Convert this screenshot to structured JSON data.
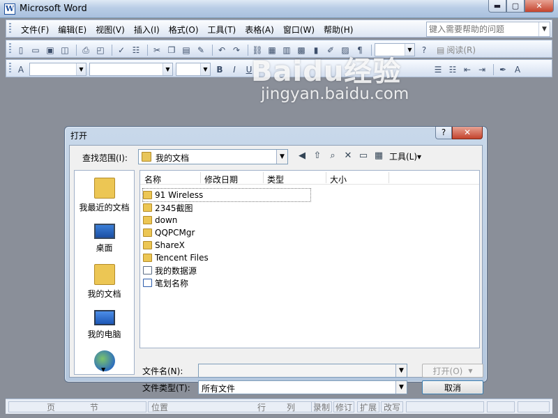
{
  "window": {
    "title": "Microsoft Word",
    "app_icon": "W",
    "minimize_glyph": "▬",
    "maximize_glyph": "▢",
    "close_glyph": "✕"
  },
  "menu": {
    "items": [
      "文件(F)",
      "编辑(E)",
      "视图(V)",
      "插入(I)",
      "格式(O)",
      "工具(T)",
      "表格(A)",
      "窗口(W)",
      "帮助(H)"
    ],
    "help_placeholder": "键入需要帮助的问题"
  },
  "toolbar": {
    "read_label": "阅读(R)",
    "bold_glyph": "B",
    "italic_glyph": "I",
    "underline_glyph": "U"
  },
  "watermark": {
    "logo": "Baidu经验",
    "url": "jingyan.baidu.com"
  },
  "dialog": {
    "title": "打开",
    "help_glyph": "?",
    "close_glyph": "✕",
    "look_in_label": "查找范围(I):",
    "look_in_value": "我的文档",
    "tools_label": "工具(L)▾",
    "places": [
      {
        "label": "我最近的文档",
        "icon": "recent-documents-icon"
      },
      {
        "label": "桌面",
        "icon": "desktop-icon"
      },
      {
        "label": "我的文档",
        "icon": "my-documents-icon"
      },
      {
        "label": "我的电脑",
        "icon": "my-computer-icon"
      },
      {
        "label": "",
        "icon": "network-places-icon"
      }
    ],
    "columns": [
      "名称",
      "修改日期",
      "类型",
      "大小"
    ],
    "files": [
      {
        "name": "91 Wireless",
        "kind": "folder"
      },
      {
        "name": "2345截图",
        "kind": "folder"
      },
      {
        "name": "down",
        "kind": "folder"
      },
      {
        "name": "QQPCMgr",
        "kind": "folder"
      },
      {
        "name": "ShareX",
        "kind": "folder"
      },
      {
        "name": "Tencent Files",
        "kind": "folder"
      },
      {
        "name": "我的数据源",
        "kind": "datasource"
      },
      {
        "name": "笔划名称",
        "kind": "document"
      }
    ],
    "filename_label": "文件名(N):",
    "filename_value": "",
    "filetype_label": "文件类型(T):",
    "filetype_value": "所有文件",
    "open_button": "打开(O)",
    "cancel_button": "取消"
  },
  "status": {
    "page": "页",
    "section": "节",
    "at": "位置",
    "line": "行",
    "column": "列",
    "rec": "录制",
    "trk": "修订",
    "ext": "扩展",
    "ovr": "改写"
  }
}
